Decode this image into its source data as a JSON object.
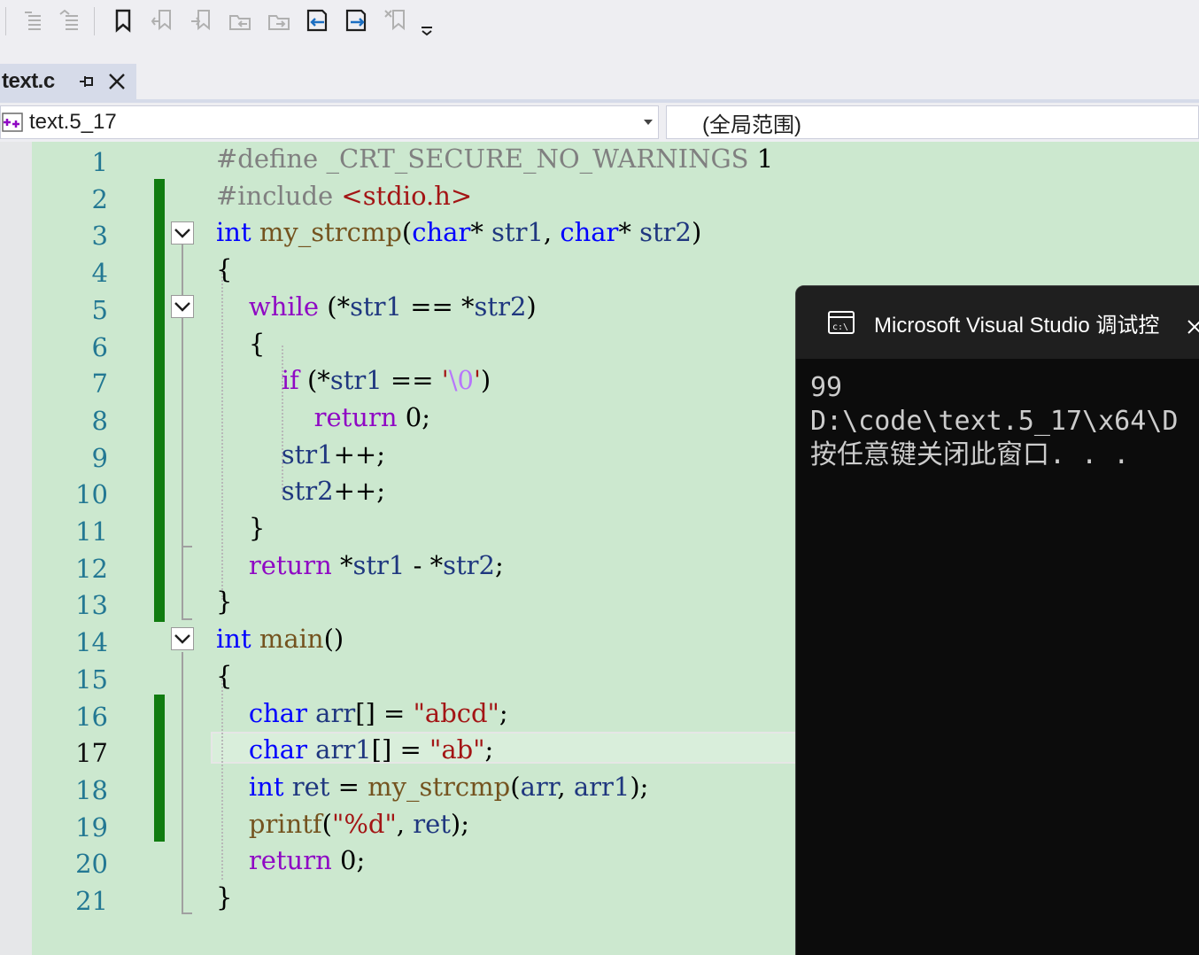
{
  "tab": {
    "label": "text.c"
  },
  "nav": {
    "project": "text.5_17",
    "scope": "(全局范围)"
  },
  "editor": {
    "current_line": 17,
    "line_numbers": [
      "1",
      "2",
      "3",
      "4",
      "5",
      "6",
      "7",
      "8",
      "9",
      "10",
      "11",
      "12",
      "13",
      "14",
      "15",
      "16",
      "17",
      "18",
      "19",
      "20",
      "21"
    ]
  },
  "console": {
    "title": "Microsoft Visual Studio 调试控",
    "output": [
      "99",
      "D:\\code\\text.5_17\\x64\\D",
      "按任意键关闭此窗口. . ."
    ]
  },
  "colors": {
    "editor_bg": "#cce8cf",
    "keyword": "#0000ff",
    "control_keyword": "#8f08c4",
    "preprocessor": "#808080",
    "string": "#a31515",
    "function": "#74531f",
    "variable": "#1f377f",
    "change_bar": "#107c10",
    "console_bg": "#0c0c0c"
  },
  "code": {
    "l1": [
      [
        "pp",
        "#define "
      ],
      [
        "pp",
        "_CRT_SECURE_NO_WARNINGS"
      ],
      [
        "plain",
        " 1"
      ]
    ],
    "l2": [
      [
        "pp",
        "#include "
      ],
      [
        "str",
        "<stdio.h>"
      ]
    ],
    "l3": [
      [
        "kw",
        "int"
      ],
      [
        "plain",
        " "
      ],
      [
        "fn",
        "my_strcmp"
      ],
      [
        "plain",
        "("
      ],
      [
        "kw",
        "char"
      ],
      [
        "plain",
        "* "
      ],
      [
        "var",
        "str1"
      ],
      [
        "plain",
        ", "
      ],
      [
        "kw",
        "char"
      ],
      [
        "plain",
        "* "
      ],
      [
        "var",
        "str2"
      ],
      [
        "plain",
        ")"
      ]
    ],
    "l4": [
      [
        "plain",
        "{"
      ]
    ],
    "l5": [
      [
        "plain",
        "    "
      ],
      [
        "ctl",
        "while"
      ],
      [
        "plain",
        " (*"
      ],
      [
        "var",
        "str1"
      ],
      [
        "plain",
        " == *"
      ],
      [
        "var",
        "str2"
      ],
      [
        "plain",
        ")"
      ]
    ],
    "l6": [
      [
        "plain",
        "    {"
      ]
    ],
    "l7": [
      [
        "plain",
        "        "
      ],
      [
        "ctl",
        "if"
      ],
      [
        "plain",
        " (*"
      ],
      [
        "var",
        "str1"
      ],
      [
        "plain",
        " == "
      ],
      [
        "str",
        "'"
      ],
      [
        "esc",
        "\\0"
      ],
      [
        "str",
        "'"
      ],
      [
        "plain",
        ")"
      ]
    ],
    "l8": [
      [
        "plain",
        "            "
      ],
      [
        "ctl",
        "return"
      ],
      [
        "plain",
        " 0;"
      ]
    ],
    "l9": [
      [
        "plain",
        "        "
      ],
      [
        "var",
        "str1"
      ],
      [
        "plain",
        "++;"
      ]
    ],
    "l10": [
      [
        "plain",
        "        "
      ],
      [
        "var",
        "str2"
      ],
      [
        "plain",
        "++;"
      ]
    ],
    "l11": [
      [
        "plain",
        "    }"
      ]
    ],
    "l12": [
      [
        "plain",
        "    "
      ],
      [
        "ctl",
        "return"
      ],
      [
        "plain",
        " *"
      ],
      [
        "var",
        "str1"
      ],
      [
        "plain",
        " - *"
      ],
      [
        "var",
        "str2"
      ],
      [
        "plain",
        ";"
      ]
    ],
    "l13": [
      [
        "plain",
        "}"
      ]
    ],
    "l14": [
      [
        "kw",
        "int"
      ],
      [
        "plain",
        " "
      ],
      [
        "fn",
        "main"
      ],
      [
        "plain",
        "()"
      ]
    ],
    "l15": [
      [
        "plain",
        "{"
      ]
    ],
    "l16": [
      [
        "plain",
        "    "
      ],
      [
        "kw",
        "char"
      ],
      [
        "plain",
        " "
      ],
      [
        "var",
        "arr"
      ],
      [
        "plain",
        "[] = "
      ],
      [
        "str",
        "\"abcd\""
      ],
      [
        "plain",
        ";"
      ]
    ],
    "l17": [
      [
        "plain",
        "    "
      ],
      [
        "kw",
        "char"
      ],
      [
        "plain",
        " "
      ],
      [
        "var",
        "arr1"
      ],
      [
        "plain",
        "[] = "
      ],
      [
        "str",
        "\"ab\""
      ],
      [
        "plain",
        ";"
      ]
    ],
    "l18": [
      [
        "plain",
        "    "
      ],
      [
        "kw",
        "int"
      ],
      [
        "plain",
        " "
      ],
      [
        "var",
        "ret"
      ],
      [
        "plain",
        " = "
      ],
      [
        "fn",
        "my_strcmp"
      ],
      [
        "plain",
        "("
      ],
      [
        "var",
        "arr"
      ],
      [
        "plain",
        ", "
      ],
      [
        "var",
        "arr1"
      ],
      [
        "plain",
        ");"
      ]
    ],
    "l19": [
      [
        "plain",
        "    "
      ],
      [
        "fn",
        "printf"
      ],
      [
        "plain",
        "("
      ],
      [
        "str",
        "\"%d\""
      ],
      [
        "plain",
        ", "
      ],
      [
        "var",
        "ret"
      ],
      [
        "plain",
        ");"
      ]
    ],
    "l20": [
      [
        "plain",
        "    "
      ],
      [
        "ctl",
        "return"
      ],
      [
        "plain",
        " 0;"
      ]
    ],
    "l21": [
      [
        "plain",
        "}"
      ]
    ]
  }
}
